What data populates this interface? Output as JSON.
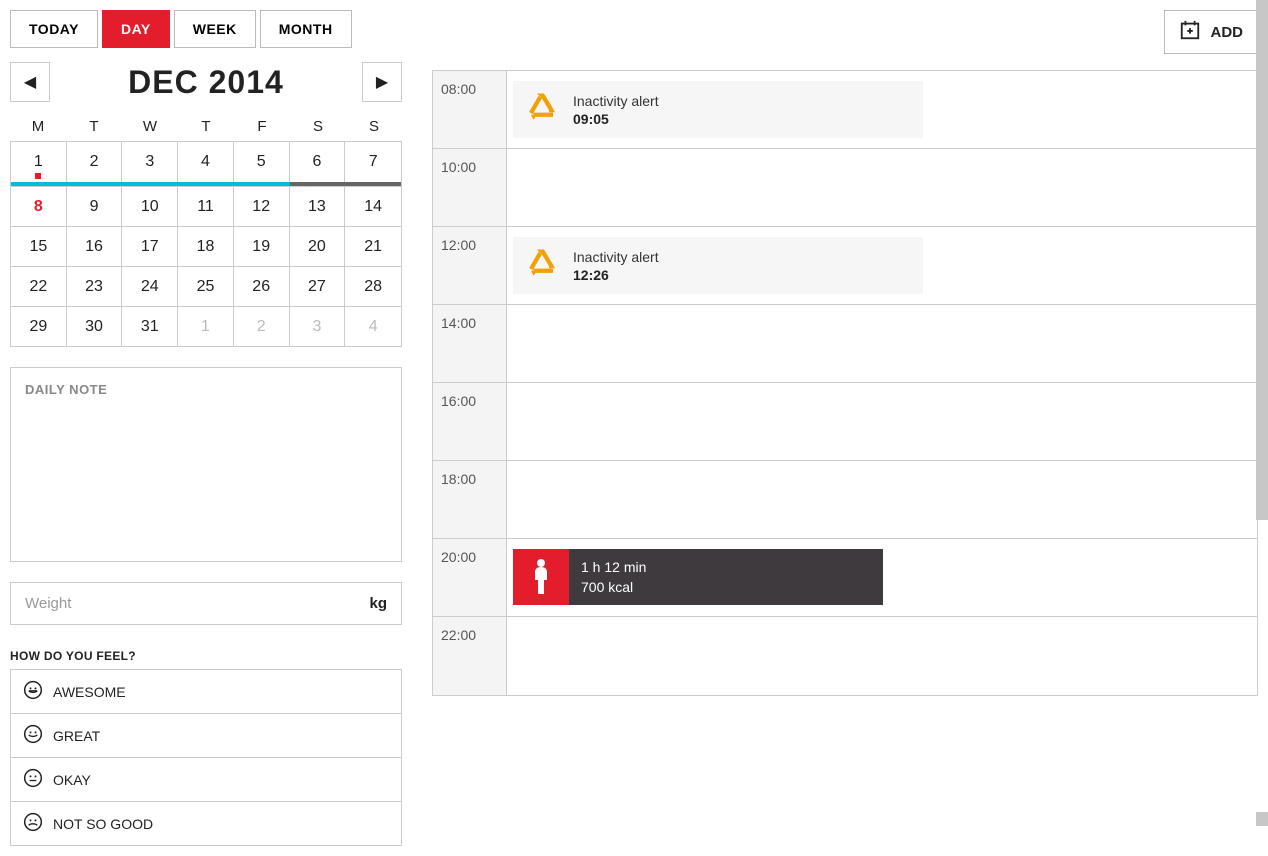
{
  "topbar": {
    "today": "TODAY",
    "day": "DAY",
    "week": "WEEK",
    "month": "MONTH"
  },
  "add_label": "ADD",
  "calendar": {
    "title": "DEC 2014",
    "dow": [
      "M",
      "T",
      "W",
      "T",
      "F",
      "S",
      "S"
    ],
    "weeks": [
      [
        {
          "n": "1",
          "selected": true
        },
        {
          "n": "2"
        },
        {
          "n": "3"
        },
        {
          "n": "4"
        },
        {
          "n": "5"
        },
        {
          "n": "6"
        },
        {
          "n": "7"
        }
      ],
      [
        {
          "n": "8",
          "today": true
        },
        {
          "n": "9"
        },
        {
          "n": "10"
        },
        {
          "n": "11"
        },
        {
          "n": "12"
        },
        {
          "n": "13"
        },
        {
          "n": "14"
        }
      ],
      [
        {
          "n": "15"
        },
        {
          "n": "16"
        },
        {
          "n": "17"
        },
        {
          "n": "18"
        },
        {
          "n": "19"
        },
        {
          "n": "20"
        },
        {
          "n": "21"
        }
      ],
      [
        {
          "n": "22"
        },
        {
          "n": "23"
        },
        {
          "n": "24"
        },
        {
          "n": "25"
        },
        {
          "n": "26"
        },
        {
          "n": "27"
        },
        {
          "n": "28"
        }
      ],
      [
        {
          "n": "29"
        },
        {
          "n": "30"
        },
        {
          "n": "31"
        },
        {
          "n": "1",
          "other": true
        },
        {
          "n": "2",
          "other": true
        },
        {
          "n": "3",
          "other": true
        },
        {
          "n": "4",
          "other": true
        }
      ]
    ],
    "week0_activity": [
      "cyan",
      "cyan",
      "cyan",
      "cyan",
      "cyan",
      "gray",
      "gray"
    ]
  },
  "daily_note": {
    "placeholder": "DAILY NOTE",
    "value": ""
  },
  "weight": {
    "placeholder": "Weight",
    "value": "",
    "unit": "kg"
  },
  "feel": {
    "title": "HOW DO YOU FEEL?",
    "options": [
      {
        "label": "AWESOME",
        "mood": "awesome"
      },
      {
        "label": "GREAT",
        "mood": "great"
      },
      {
        "label": "OKAY",
        "mood": "okay"
      },
      {
        "label": "NOT SO GOOD",
        "mood": "notsogood"
      }
    ]
  },
  "timeline": {
    "rows": [
      {
        "hour": "08:00",
        "event": {
          "type": "inactivity",
          "title": "Inactivity alert",
          "time": "09:05"
        }
      },
      {
        "hour": "10:00"
      },
      {
        "hour": "12:00",
        "event": {
          "type": "inactivity",
          "title": "Inactivity alert",
          "time": "12:26"
        }
      },
      {
        "hour": "14:00"
      },
      {
        "hour": "16:00"
      },
      {
        "hour": "18:00"
      },
      {
        "hour": "20:00",
        "event": {
          "type": "workout",
          "duration": "1 h 12 min",
          "energy": "700 kcal"
        }
      },
      {
        "hour": "22:00"
      }
    ]
  }
}
